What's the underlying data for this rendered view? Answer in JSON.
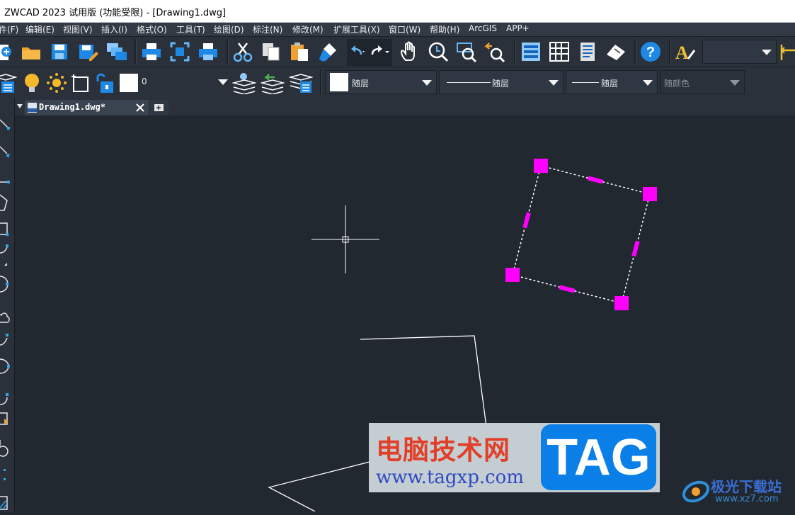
{
  "window": {
    "title": "ZWCAD 2023 试用版 (功能受限) - [Drawing1.dwg]"
  },
  "menu": {
    "items": [
      "件(F)",
      "编辑(E)",
      "视图(V)",
      "插入(I)",
      "格式(O)",
      "工具(T)",
      "绘图(D)",
      "标注(N)",
      "修改(M)",
      "扩展工具(X)",
      "窗口(W)",
      "帮助(H)",
      "ArcGIS",
      "APP+"
    ]
  },
  "layer_toolbar": {
    "current_layer": "0",
    "color": "随层",
    "linetype": "随层",
    "lineweight": "随层",
    "plot_style": "随颜色"
  },
  "tabs": {
    "document": "Drawing1.dwg*"
  },
  "watermark": {
    "title": "电脑技术网",
    "url": "www.tagxp.com",
    "tag": "TAG",
    "brand": "极光下载站",
    "site": "www.xz7.com"
  },
  "colors": {
    "canvas": "#212830",
    "grip": "#ff00ff",
    "toolbar": "#2a313b",
    "accent_icon": "#2fa6e8"
  },
  "icons": {
    "toolbar1": [
      "new-icon",
      "open-icon",
      "save-icon",
      "save-as-icon",
      "multi-window-icon",
      "print-icon",
      "print-preview-icon",
      "plot-icon",
      "cut-icon",
      "copy-icon",
      "paste-icon",
      "match-properties-icon",
      "undo-icon",
      "redo-icon",
      "pan-icon",
      "zoom-realtime-icon",
      "zoom-window-icon",
      "zoom-previous-icon",
      "properties-icon",
      "design-center-icon",
      "tool-palette-icon",
      "sheet-icon",
      "help-icon",
      "text-style-icon"
    ]
  }
}
